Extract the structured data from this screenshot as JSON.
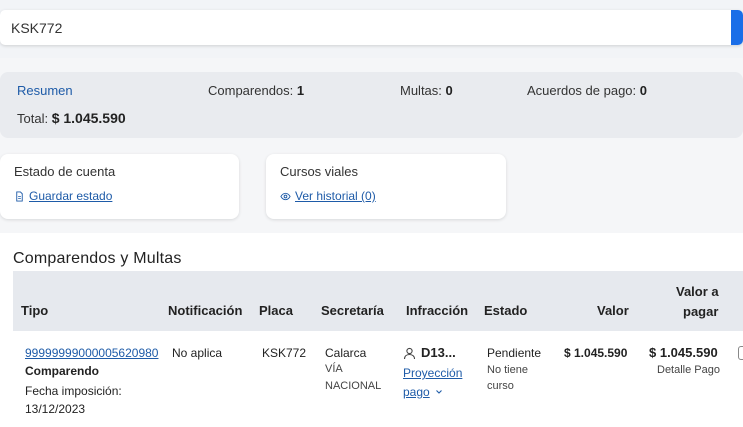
{
  "search": {
    "value": "KSK772"
  },
  "summary": {
    "title": "Resumen",
    "comparendos_label": "Comparendos:",
    "comparendos_value": "1",
    "multas_label": "Multas:",
    "multas_value": "0",
    "acuerdos_label": "Acuerdos de pago:",
    "acuerdos_value": "0",
    "total_label": "Total:",
    "total_value": "$ 1.045.590"
  },
  "cards": {
    "estado": {
      "title": "Estado de cuenta",
      "link": "Guardar estado"
    },
    "cursos": {
      "title": "Cursos viales",
      "link": "Ver historial (0)"
    }
  },
  "section_title": "Comparendos y Multas",
  "table": {
    "headers": {
      "tipo": "Tipo",
      "notificacion": "Notificación",
      "placa": "Placa",
      "secretaria": "Secretaría",
      "infraccion": "Infracción",
      "estado": "Estado",
      "valor": "Valor",
      "valor_pagar_1": "Valor a",
      "valor_pagar_2": "pagar"
    },
    "row": {
      "numero": "99999999000005620980",
      "tipo": "Comparendo",
      "fecha_label": "Fecha imposición:",
      "fecha": "13/12/2023",
      "notificacion": "No aplica",
      "placa": "KSK772",
      "secretaria": "Calarca",
      "secretaria_sub_1": "VÍA",
      "secretaria_sub_2": "NACIONAL",
      "infraccion_code": "D13...",
      "proyeccion_1": "Proyección",
      "proyeccion_2": "pago",
      "estado": "Pendiente",
      "curso_1": "No tiene",
      "curso_2": "curso",
      "valor": "$ 1.045.590",
      "valor_pagar": "$ 1.045.590",
      "detalle": "Detalle Pago"
    }
  }
}
